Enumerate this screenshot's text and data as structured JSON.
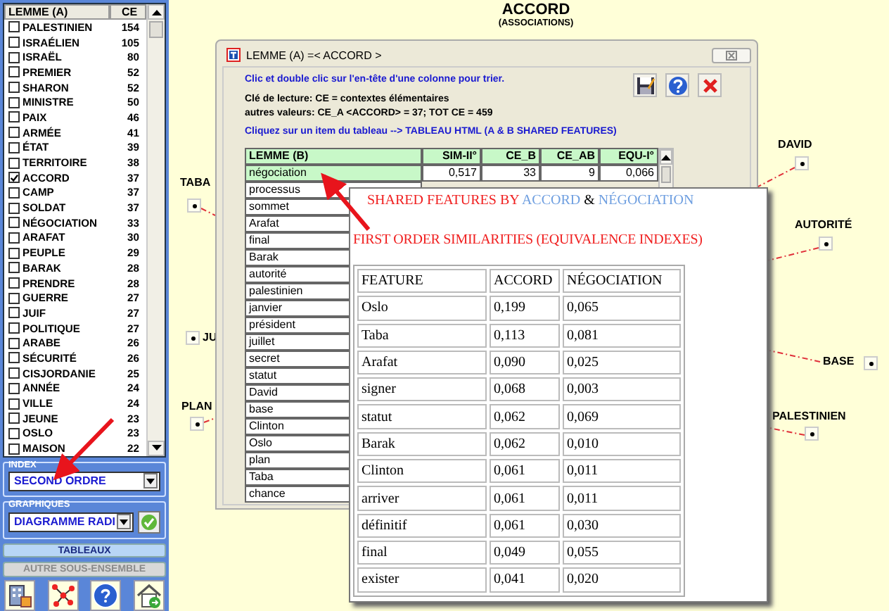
{
  "sidebar": {
    "list": {
      "columns": [
        "LEMME (A)",
        "CE"
      ],
      "items": [
        {
          "label": "PALESTINIEN",
          "count": "154",
          "checked": false
        },
        {
          "label": "ISRAÉLIEN",
          "count": "105",
          "checked": false
        },
        {
          "label": "ISRAËL",
          "count": "80",
          "checked": false
        },
        {
          "label": "PREMIER",
          "count": "52",
          "checked": false
        },
        {
          "label": "SHARON",
          "count": "52",
          "checked": false
        },
        {
          "label": "MINISTRE",
          "count": "50",
          "checked": false
        },
        {
          "label": "PAIX",
          "count": "46",
          "checked": false
        },
        {
          "label": "ARMÉE",
          "count": "41",
          "checked": false
        },
        {
          "label": "ÉTAT",
          "count": "39",
          "checked": false
        },
        {
          "label": "TERRITOIRE",
          "count": "38",
          "checked": false
        },
        {
          "label": "ACCORD",
          "count": "37",
          "checked": true
        },
        {
          "label": "CAMP",
          "count": "37",
          "checked": false
        },
        {
          "label": "SOLDAT",
          "count": "37",
          "checked": false
        },
        {
          "label": "NÉGOCIATION",
          "count": "33",
          "checked": false
        },
        {
          "label": "ARAFAT",
          "count": "30",
          "checked": false
        },
        {
          "label": "PEUPLE",
          "count": "29",
          "checked": false
        },
        {
          "label": "BARAK",
          "count": "28",
          "checked": false
        },
        {
          "label": "PRENDRE",
          "count": "28",
          "checked": false
        },
        {
          "label": "GUERRE",
          "count": "27",
          "checked": false
        },
        {
          "label": "JUIF",
          "count": "27",
          "checked": false
        },
        {
          "label": "POLITIQUE",
          "count": "27",
          "checked": false
        },
        {
          "label": "ARABE",
          "count": "26",
          "checked": false
        },
        {
          "label": "SÉCURITÉ",
          "count": "26",
          "checked": false
        },
        {
          "label": "CISJORDANIE",
          "count": "25",
          "checked": false
        },
        {
          "label": "ANNÉE",
          "count": "24",
          "checked": false
        },
        {
          "label": "VILLE",
          "count": "24",
          "checked": false
        },
        {
          "label": "JEUNE",
          "count": "23",
          "checked": false
        },
        {
          "label": "OSLO",
          "count": "23",
          "checked": false
        },
        {
          "label": "MAISON",
          "count": "22",
          "checked": false
        }
      ]
    },
    "index": {
      "label": "INDEX",
      "value": "SECOND ORDRE"
    },
    "graphics": {
      "label": "GRAPHIQUES",
      "value": "DIAGRAMME RADI"
    },
    "buttons": [
      {
        "label": "TABLEAUX",
        "disabled": false
      },
      {
        "label": "AUTRE SOUS-ENSEMBLE",
        "disabled": true
      }
    ]
  },
  "graph": {
    "title": "ACCORD",
    "subtitle": "(ASSOCIATIONS)",
    "nodes": [
      {
        "label": "TABA"
      },
      {
        "label": "JU"
      },
      {
        "label": "PLAN"
      },
      {
        "label": "DAVID"
      },
      {
        "label": "AUTORITÉ"
      },
      {
        "label": "BASE"
      },
      {
        "label": "PALESTINIEN"
      }
    ]
  },
  "dialog": {
    "title": "LEMME (A) =< ACCORD >",
    "instructions": "Clic et double clic sur l'en-tête d'une colonne pour trier.",
    "legend": [
      "Clé de lecture: CE = contextes élémentaires",
      "autres valeurs: CE_A <ACCORD> = 37; TOT CE = 459"
    ],
    "link_hint": "Cliquez sur un item du tableau --> TABLEAU  HTML (A & B SHARED FEATURES)",
    "table": {
      "columns": [
        "LEMME (B)",
        "SIM-II°",
        "CE_B",
        "CE_AB",
        "EQU-I°"
      ],
      "rows": [
        {
          "cells": [
            "négociation",
            "0,517",
            "33",
            "9",
            "0,066"
          ],
          "selected": true
        },
        {
          "cells": [
            "processus"
          ],
          "selected": false
        },
        {
          "cells": [
            "sommet"
          ],
          "selected": false
        },
        {
          "cells": [
            "Arafat"
          ],
          "selected": false
        },
        {
          "cells": [
            "final"
          ],
          "selected": false
        },
        {
          "cells": [
            "Barak"
          ],
          "selected": false
        },
        {
          "cells": [
            "autorité"
          ],
          "selected": false
        },
        {
          "cells": [
            "palestinien"
          ],
          "selected": false
        },
        {
          "cells": [
            "janvier"
          ],
          "selected": false
        },
        {
          "cells": [
            "président"
          ],
          "selected": false
        },
        {
          "cells": [
            "juillet"
          ],
          "selected": false
        },
        {
          "cells": [
            "secret"
          ],
          "selected": false
        },
        {
          "cells": [
            "statut"
          ],
          "selected": false
        },
        {
          "cells": [
            "David"
          ],
          "selected": false
        },
        {
          "cells": [
            "base"
          ],
          "selected": false
        },
        {
          "cells": [
            "Clinton"
          ],
          "selected": false
        },
        {
          "cells": [
            "Oslo"
          ],
          "selected": false
        },
        {
          "cells": [
            "plan"
          ],
          "selected": false
        },
        {
          "cells": [
            "Taba"
          ],
          "selected": false
        },
        {
          "cells": [
            "chance"
          ],
          "selected": false
        }
      ]
    }
  },
  "popup": {
    "title": [
      {
        "text": "SHARED FEATURES BY ",
        "kind": "plain"
      },
      {
        "text": "ACCORD",
        "kind": "term"
      },
      {
        "text": " & ",
        "kind": "joiner"
      },
      {
        "text": "NÉGOCIATION",
        "kind": "term"
      }
    ],
    "subtitle": "FIRST ORDER SIMILARITIES (EQUIVALENCE INDEXES)",
    "table": {
      "columns": [
        "FEATURE",
        "ACCORD",
        "NÉGOCIATION"
      ],
      "rows": [
        [
          "Oslo",
          "0,199",
          "0,065"
        ],
        [
          "Taba",
          "0,113",
          "0,081"
        ],
        [
          "Arafat",
          "0,090",
          "0,025"
        ],
        [
          "signer",
          "0,068",
          "0,003"
        ],
        [
          "statut",
          "0,062",
          "0,069"
        ],
        [
          "Barak",
          "0,062",
          "0,010"
        ],
        [
          "Clinton",
          "0,061",
          "0,011"
        ],
        [
          "arriver",
          "0,061",
          "0,011"
        ],
        [
          "définitif",
          "0,061",
          "0,030"
        ],
        [
          "final",
          "0,049",
          "0,055"
        ],
        [
          "exister",
          "0,041",
          "0,020"
        ]
      ]
    }
  }
}
